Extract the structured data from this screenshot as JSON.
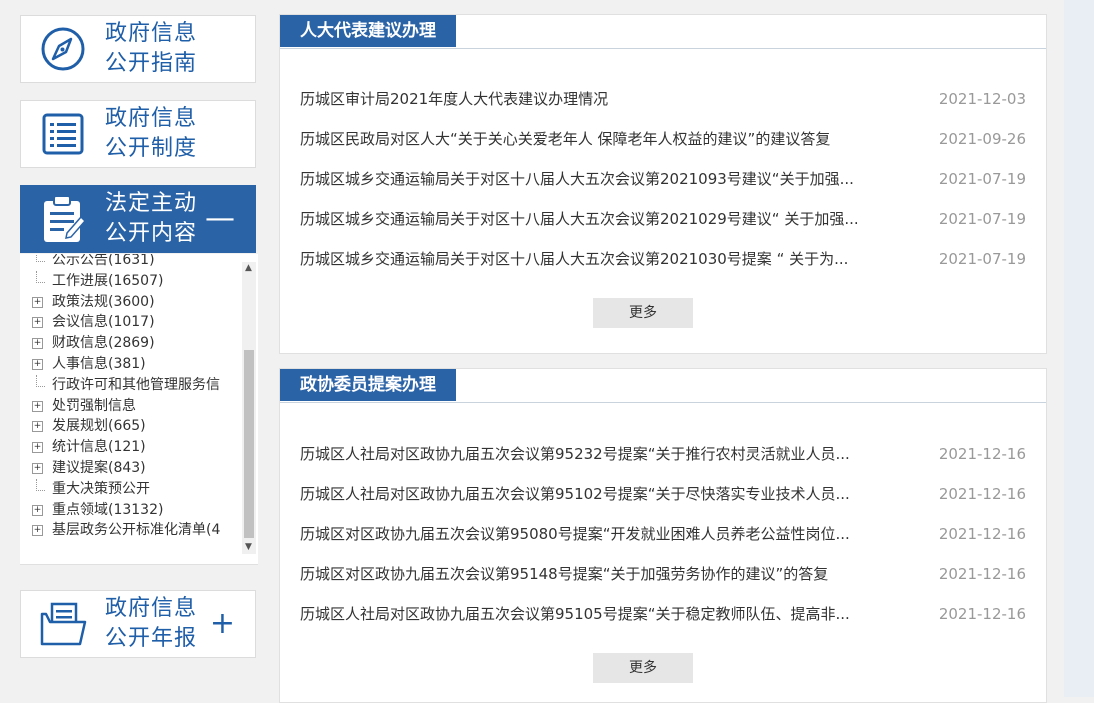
{
  "sidebar": {
    "cards": [
      {
        "line1": "政府信息",
        "line2": "公开指南",
        "icon": "compass-icon"
      },
      {
        "line1": "政府信息",
        "line2": "公开制度",
        "icon": "list-document-icon"
      },
      {
        "line1": "法定主动",
        "line2": "公开内容",
        "icon": "clipboard-edit-icon",
        "sign": "—"
      },
      {
        "line1": "政府信息",
        "line2": "公开年报",
        "icon": "folder-document-icon",
        "sign": "+"
      }
    ],
    "tree": [
      {
        "label": "公示公告(1631)",
        "expandable": false
      },
      {
        "label": "工作进展(16507)",
        "expandable": false
      },
      {
        "label": "政策法规(3600)",
        "expandable": true
      },
      {
        "label": "会议信息(1017)",
        "expandable": true
      },
      {
        "label": "财政信息(2869)",
        "expandable": true
      },
      {
        "label": "人事信息(381)",
        "expandable": true
      },
      {
        "label": "行政许可和其他管理服务信",
        "expandable": false
      },
      {
        "label": "处罚强制信息",
        "expandable": true
      },
      {
        "label": "发展规划(665)",
        "expandable": true
      },
      {
        "label": "统计信息(121)",
        "expandable": true
      },
      {
        "label": "建议提案(843)",
        "expandable": true
      },
      {
        "label": "重大决策预公开",
        "expandable": false
      },
      {
        "label": "重点领域(13132)",
        "expandable": true
      },
      {
        "label": "基层政务公开标准化清单(4",
        "expandable": true
      }
    ]
  },
  "panels": [
    {
      "title": "人大代表建议办理",
      "more": "更多",
      "items": [
        {
          "title": "历城区审计局2021年度人大代表建议办理情况",
          "date": "2021-12-03"
        },
        {
          "title": "历城区民政局对区人大“关于关心关爱老年人 保障老年人权益的建议”的建议答复",
          "date": "2021-09-26"
        },
        {
          "title": "历城区城乡交通运输局关于对区十八届人大五次会议第2021093号建议“关于加强...",
          "date": "2021-07-19"
        },
        {
          "title": "历城区城乡交通运输局关于对区十八届人大五次会议第2021029号建议“ 关于加强...",
          "date": "2021-07-19"
        },
        {
          "title": "历城区城乡交通运输局关于对区十八届人大五次会议第2021030号提案 “ 关于为...",
          "date": "2021-07-19"
        }
      ]
    },
    {
      "title": "政协委员提案办理",
      "more": "更多",
      "items": [
        {
          "title": "历城区人社局对区政协九届五次会议第95232号提案“关于推行农村灵活就业人员...",
          "date": "2021-12-16"
        },
        {
          "title": "历城区人社局对区政协九届五次会议第95102号提案“关于尽快落实专业技术人员...",
          "date": "2021-12-16"
        },
        {
          "title": "历城区对区政协九届五次会议第95080号提案“开发就业困难人员养老公益性岗位...",
          "date": "2021-12-16"
        },
        {
          "title": "历城区对区政协九届五次会议第95148号提案“关于加强劳务协作的建议”的答复",
          "date": "2021-12-16"
        },
        {
          "title": "历城区人社局对区政协九届五次会议第95105号提案“关于稳定教师队伍、提高非...",
          "date": "2021-12-16"
        }
      ]
    }
  ],
  "colors": {
    "accent": "#2b63a7",
    "icon": "#1f5ea8",
    "date": "#999999"
  }
}
